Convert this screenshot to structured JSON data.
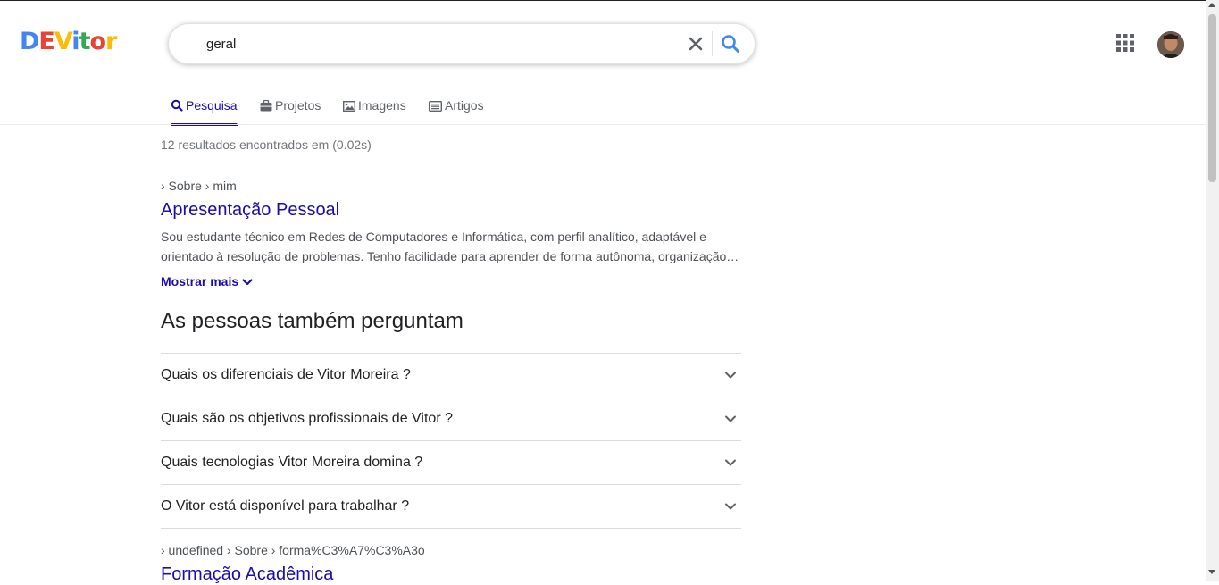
{
  "logo": {
    "letters": [
      {
        "char": "D",
        "color": "#4285f4"
      },
      {
        "char": "E",
        "color": "#ea4335"
      },
      {
        "char": "V",
        "color": "#fbbc05"
      },
      {
        "char": "i",
        "color": "#4285f4"
      },
      {
        "char": "t",
        "color": "#34a853"
      },
      {
        "char": "o",
        "color": "#ea4335"
      },
      {
        "char": "r",
        "color": "#fbbc05"
      }
    ]
  },
  "search": {
    "value": "geral",
    "clear_icon": "close-icon",
    "search_icon": "search-icon"
  },
  "header": {
    "apps_icon": "grid-icon",
    "avatar": "user-avatar"
  },
  "tabs": [
    {
      "label": "Pesquisa",
      "icon": "search-icon",
      "active": true
    },
    {
      "label": "Projetos",
      "icon": "briefcase-icon",
      "active": false
    },
    {
      "label": "Imagens",
      "icon": "image-icon",
      "active": false
    },
    {
      "label": "Artigos",
      "icon": "newspaper-icon",
      "active": false
    }
  ],
  "stats": "12 resultados encontrados em (0.02s)",
  "result1": {
    "breadcrumb": "› Sobre › mim",
    "title": "Apresentação Pessoal",
    "snippet": "Sou estudante técnico em Redes de Computadores e Informática, com perfil analítico, adaptável e orientado à resolução de problemas. Tenho facilidade para aprender de forma autônoma, organização e trabalho em equipe.",
    "show_more": "Mostrar mais"
  },
  "people_also_ask": {
    "title": "As pessoas também perguntam",
    "questions": [
      "Quais os diferenciais de Vitor Moreira ?",
      "Quais são os objetivos profissionais de Vitor ?",
      "Quais tecnologias Vitor Moreira domina ?",
      "O Vitor está disponível para trabalhar ?"
    ]
  },
  "result2": {
    "breadcrumb": "› undefined › Sobre › forma%C3%A7%C3%A3o",
    "title": "Formação Acadêmica"
  },
  "colors": {
    "link": "#1a0dab",
    "text": "#202124",
    "muted": "#70757a",
    "search_blue": "#4285f4"
  }
}
